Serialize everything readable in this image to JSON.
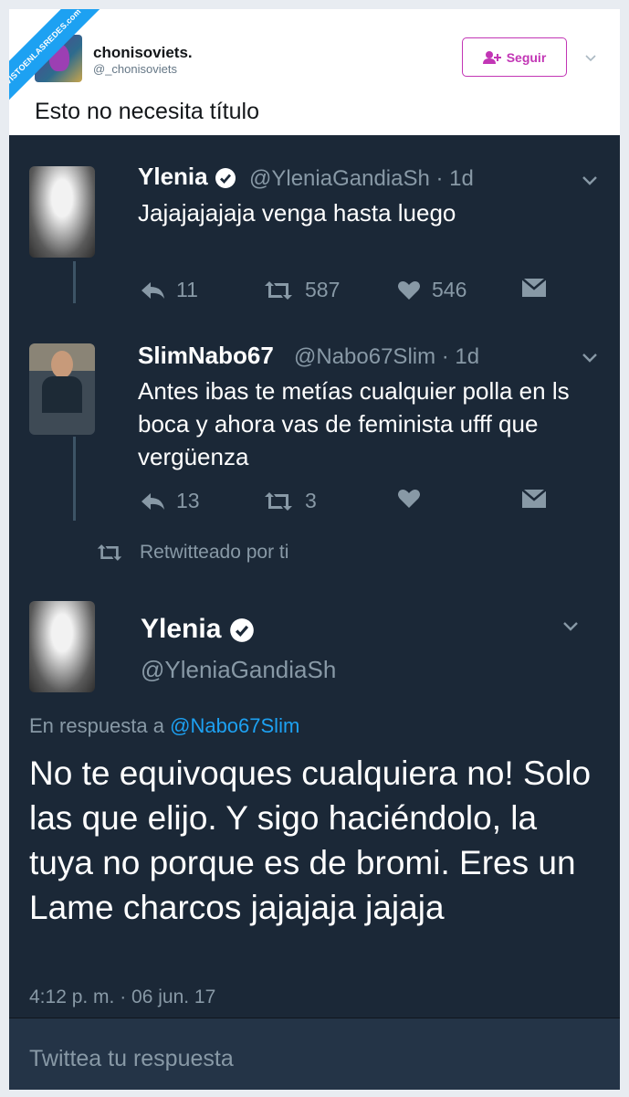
{
  "watermark": "VISTOENLASREDES.com",
  "header": {
    "user_name": "chonisoviets.",
    "user_handle": "@_chonisoviets",
    "follow_label": "Seguir",
    "caption": "Esto no necesita título"
  },
  "tweet1": {
    "name": "Ylenia",
    "handle_time": "@YleniaGandiaSh · 1d",
    "text": "Jajajajajaja venga hasta luego",
    "replies": "11",
    "retweets": "587",
    "likes": "546"
  },
  "tweet2": {
    "name": "SlimNabo67",
    "handle_time": "@Nabo67Slim · 1d",
    "text": "Antes ibas te metías cualquier polla en ls boca y ahora vas de feminista ufff que vergüenza",
    "replies": "13",
    "retweets": "3"
  },
  "retweeted_label": "Retwitteado por ti",
  "tweet3": {
    "name": "Ylenia",
    "handle": "@YleniaGandiaSh",
    "reply_prefix": "En respuesta a",
    "reply_target": "@Nabo67Slim",
    "text": "No te equivoques cualquiera no! Solo las que elijo. Y sigo haciéndolo, la tuya no porque es de bromi. Eres un Lame charcos jajajaja jajaja",
    "timestamp": "4:12 p. m. · 06 jun. 17"
  },
  "reply_placeholder": "Twittea tu respuesta",
  "colors": {
    "brand": "#1da1f2",
    "follow_accent": "#c236b5",
    "dark_bg": "#1b2837",
    "muted": "#8899a6"
  }
}
